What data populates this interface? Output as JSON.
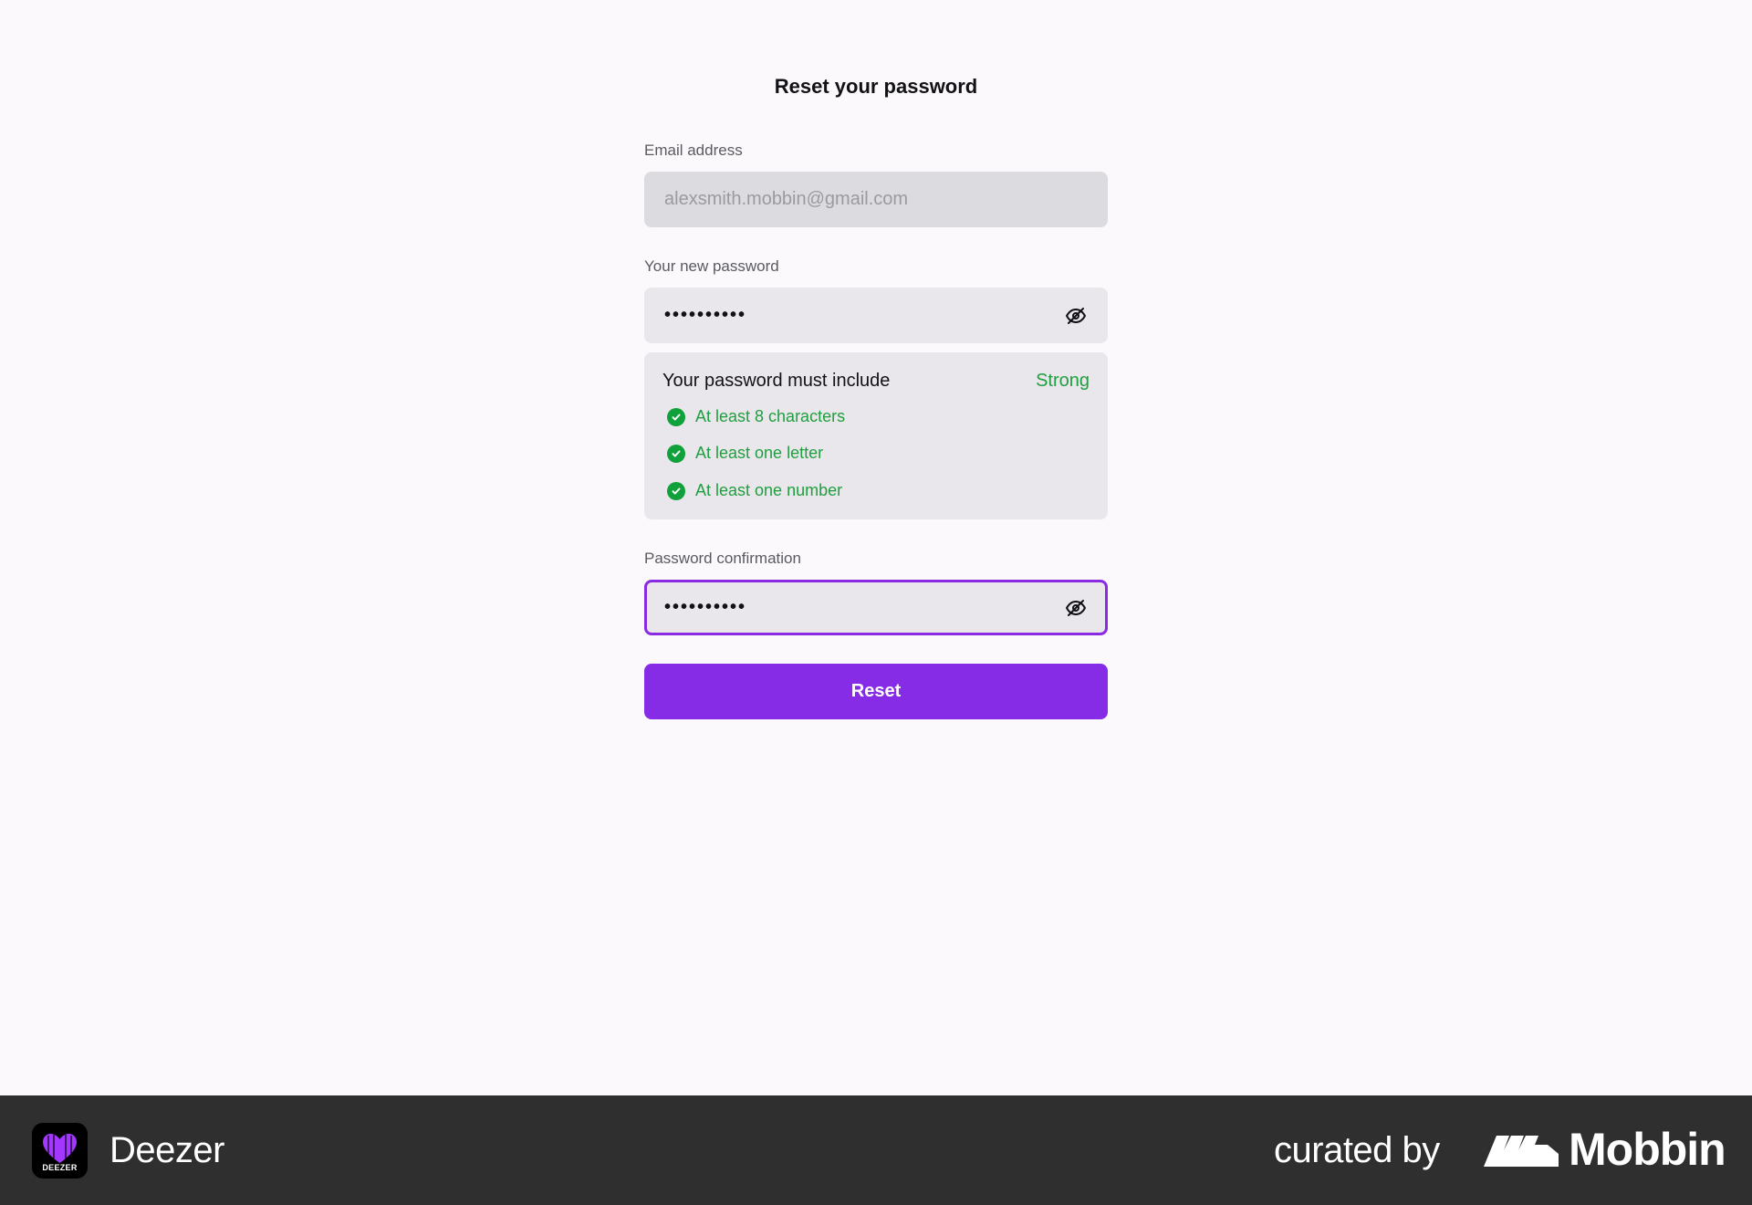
{
  "form": {
    "title": "Reset your password",
    "email": {
      "label": "Email address",
      "value": "alexsmith.mobbin@gmail.com"
    },
    "new_password": {
      "label": "Your new password",
      "value": "••••••••••",
      "toggle_icon": "eye-off-icon"
    },
    "requirements": {
      "title": "Your password must include",
      "strength": "Strong",
      "items": [
        "At least 8 characters",
        "At least one letter",
        "At least one number"
      ]
    },
    "confirm_password": {
      "label": "Password confirmation",
      "value": "••••••••••",
      "toggle_icon": "eye-off-icon"
    },
    "submit_label": "Reset"
  },
  "footer": {
    "app_icon_text": "DEEZER",
    "app_name": "Deezer",
    "curated_by": "curated by",
    "brand": "Mobbin"
  },
  "colors": {
    "accent": "#872ce6",
    "success": "#1f9f3f",
    "footer_bg": "#2f2f2f"
  }
}
